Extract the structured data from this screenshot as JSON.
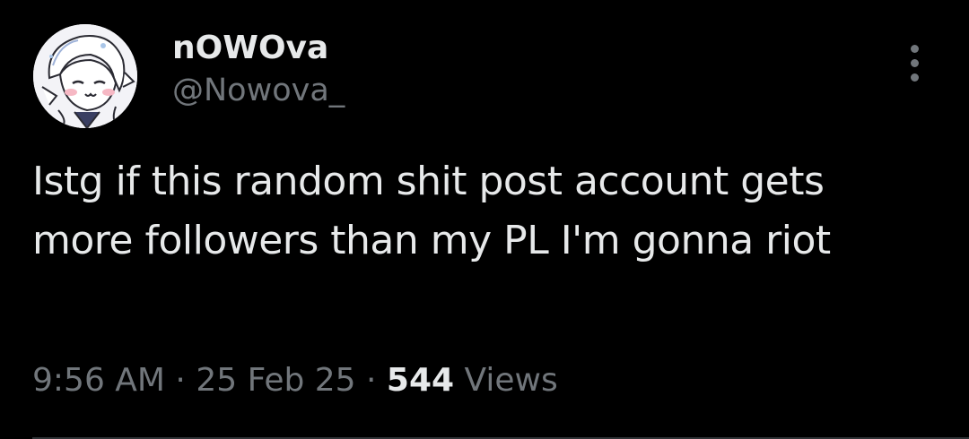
{
  "tweet": {
    "author": {
      "display_name": "nOWOva",
      "handle": "@Nowova_",
      "avatar_icon": "avatar-anime-girl-icon"
    },
    "more_icon": "more-vertical-icon",
    "text": "Istg if this random shit post account gets more followers than my PL I'm gonna riot",
    "meta": {
      "time": "9:56 AM",
      "separator": " · ",
      "date": "25 Feb 25",
      "views_count": "544",
      "views_label": " Views"
    }
  },
  "colors": {
    "background": "#000000",
    "primary_text": "#e7e9ea",
    "secondary_text": "#71767b"
  }
}
